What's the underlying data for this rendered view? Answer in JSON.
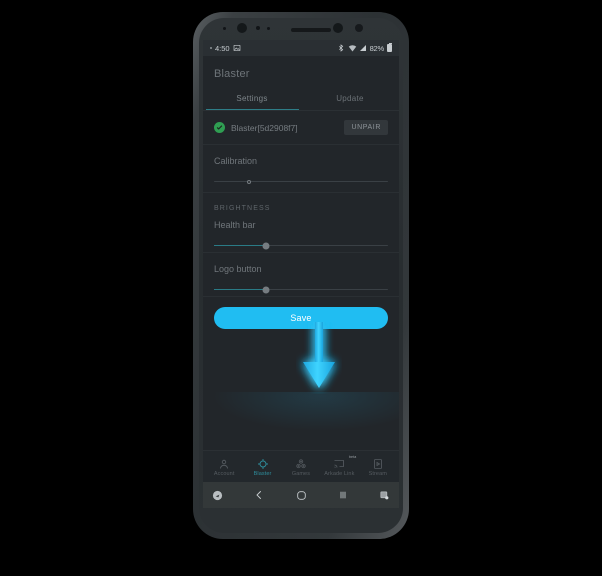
{
  "device": {
    "status_bar": {
      "time": "4:50",
      "left_icons": [
        "image-icon"
      ],
      "right_icons": [
        "bluetooth-icon",
        "wifi-icon",
        "signal-icon"
      ],
      "battery_percent": "82%"
    },
    "android_nav": {
      "assistant_label": "assistant-button",
      "back_label": "back-button",
      "home_label": "home-button",
      "recents_label": "recents-button",
      "screenshot_label": "screenshot-button"
    }
  },
  "app": {
    "title": "Blaster",
    "tabs": [
      {
        "label": "Settings",
        "active": true
      },
      {
        "label": "Update",
        "active": false
      }
    ],
    "device_row": {
      "status_icon": "check-circle-icon",
      "name": "Blaster[5d2908f7]",
      "unpair_label": "UNPAIR"
    },
    "calibration": {
      "label": "Calibration",
      "value_percent": 20
    },
    "brightness": {
      "section_label": "BRIGHTNESS",
      "sliders": [
        {
          "label": "Health bar",
          "value_percent": 30
        },
        {
          "label": "Logo button",
          "value_percent": 30
        }
      ]
    },
    "save_button": {
      "label": "Save",
      "color": "#20bdf2"
    },
    "bottom_nav": [
      {
        "label": "Account",
        "icon": "person-icon",
        "active": false,
        "badge": ""
      },
      {
        "label": "Blaster",
        "icon": "crosshair-icon",
        "active": true,
        "badge": ""
      },
      {
        "label": "Games",
        "icon": "games-icon",
        "active": false,
        "badge": ""
      },
      {
        "label": "Arkade Link",
        "icon": "cast-icon",
        "active": false,
        "badge": "beta"
      },
      {
        "label": "Stream",
        "icon": "stream-icon",
        "active": false,
        "badge": ""
      }
    ]
  },
  "annotation": {
    "arrow": "down-arrow-pointing-to-save-button",
    "arrow_color": "#29c3f5"
  },
  "theme": {
    "accent": "#20bdf2",
    "teal": "#2e8d9c",
    "background": "#22262a"
  }
}
